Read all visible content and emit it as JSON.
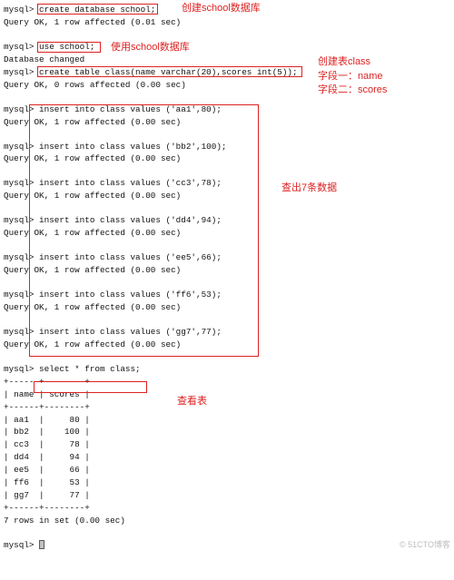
{
  "prompt": "mysql>",
  "cmds": {
    "create_db": "create database school;",
    "use_db": "use school;",
    "create_table": "create table class(name varchar(20),scores int(5));"
  },
  "resp": {
    "ok_sel": "Query OK, 1 row affected (0.01 sec)",
    "db_changed": "Database changed",
    "ok_zero": "Query OK, 0 rows affected (0.00 sec)",
    "ok_one": "Query OK, 1 row affected (0.00 sec)",
    "rows_in_set": "7 rows in set (0.00 sec)"
  },
  "inserts": [
    "insert into class values ('aa1',80);",
    "insert into class values ('bb2',100);",
    "insert into class values ('cc3',78);",
    "insert into class values ('dd4',94);",
    "insert into class values ('ee5',66);",
    "insert into class values ('ff6',53);",
    "insert into class values ('gg7',77);"
  ],
  "select_cmd": "select * from class;",
  "table": {
    "border_top": "+------+--------+",
    "header": "| name | scores |",
    "rows": [
      "| aa1  |     80 |",
      "| bb2  |    100 |",
      "| cc3  |     78 |",
      "| dd4  |     94 |",
      "| ee5  |     66 |",
      "| ff6  |     53 |",
      "| gg7  |     77 |"
    ]
  },
  "ann": {
    "a1": "创建school数据库",
    "a2": "使用school数据库",
    "a3": "创建表class",
    "a4": "字段一：name",
    "a5": "字段二：scores",
    "a6": "查出7条数据",
    "a7": "查看表"
  },
  "watermark": "© 51CTO博客",
  "chart_data": {
    "type": "table",
    "title": "select * from class",
    "columns": [
      "name",
      "scores"
    ],
    "rows": [
      [
        "aa1",
        80
      ],
      [
        "bb2",
        100
      ],
      [
        "cc3",
        78
      ],
      [
        "dd4",
        94
      ],
      [
        "ee5",
        66
      ],
      [
        "ff6",
        53
      ],
      [
        "gg7",
        77
      ]
    ]
  }
}
